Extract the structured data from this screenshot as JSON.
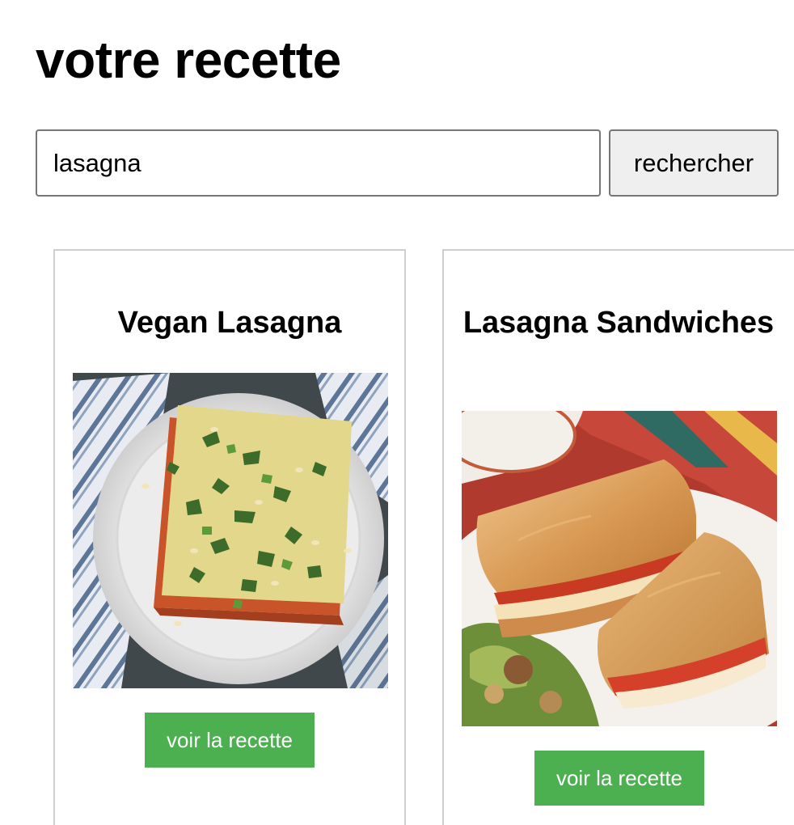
{
  "header": {
    "title": "votre recette"
  },
  "search": {
    "value": "lasagna",
    "button_label": "rechercher"
  },
  "recipes": [
    {
      "title": "Vegan Lasagna",
      "image_icon": "lasagna-plate-photo",
      "button_label": "voir la recette"
    },
    {
      "title": "Lasagna Sandwiches",
      "image_icon": "grilled-sandwich-photo",
      "button_label": "voir la recette"
    }
  ],
  "colors": {
    "accent_button": "#4caf50",
    "search_button_bg": "#efefef",
    "card_border": "#cfcfcf"
  }
}
